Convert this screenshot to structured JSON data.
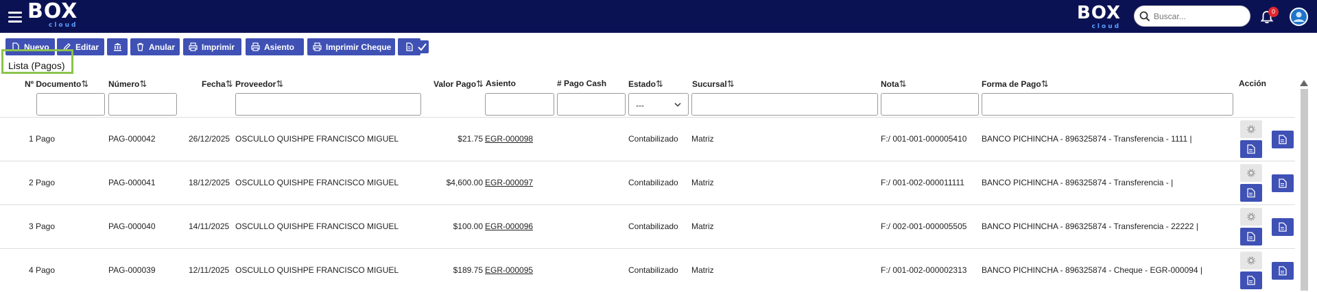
{
  "header": {
    "logo_text": "BOX",
    "logo_sub": "cloud",
    "search_placeholder": "Buscar...",
    "notification_count": "0",
    "brand_color": "#0b1254",
    "accent_color": "#3f51b5"
  },
  "toolbar": {
    "buttons": [
      {
        "label": "Nuevo",
        "icon": "file-icon"
      },
      {
        "label": "Editar",
        "icon": "pencil-icon"
      },
      {
        "label": "",
        "icon": "bank-icon"
      },
      {
        "label": "Anular",
        "icon": "trash-icon"
      },
      {
        "label": "Imprimir",
        "icon": "printer-icon"
      },
      {
        "label": "Asiento",
        "icon": "printer-icon"
      },
      {
        "label": "Imprimir Cheque",
        "icon": "printer-icon"
      },
      {
        "label": "",
        "icon": "pdf-file-icon"
      }
    ],
    "checkbox_checked": true
  },
  "list_title": "Lista (Pagos)",
  "columns": {
    "documento": "Nº Documento",
    "numero": "Número",
    "fecha": "Fecha",
    "proveedor": "Proveedor",
    "valor": "Valor Pago",
    "asiento": "Asiento",
    "pago_cash": "# Pago Cash",
    "estado": "Estado",
    "sucursal": "Sucursal",
    "nota": "Nota",
    "forma_pago": "Forma de Pago",
    "accion": "Acción"
  },
  "sort_indicator": "⇅",
  "estado_filter_value": "---",
  "rows": [
    {
      "doc": "1 Pago",
      "numero": "PAG-000042",
      "fecha": "26/12/2025",
      "proveedor": "OSCULLO QUISHPE FRANCISCO MIGUEL",
      "valor": "$21.75",
      "asiento": "EGR-000098",
      "estado": "Contabilizado",
      "sucursal": "Matriz",
      "nota": "F:/ 001-001-000005410",
      "forma": "BANCO PICHINCHA - 896325874 - Transferencia - 1111 |"
    },
    {
      "doc": "2 Pago",
      "numero": "PAG-000041",
      "fecha": "18/12/2025",
      "proveedor": "OSCULLO QUISHPE FRANCISCO MIGUEL",
      "valor": "$4,600.00",
      "asiento": "EGR-000097",
      "estado": "Contabilizado",
      "sucursal": "Matriz",
      "nota": "F:/ 001-002-000011111",
      "forma": "BANCO PICHINCHA - 896325874 - Transferencia - |"
    },
    {
      "doc": "3 Pago",
      "numero": "PAG-000040",
      "fecha": "14/11/2025",
      "proveedor": "OSCULLO QUISHPE FRANCISCO MIGUEL",
      "valor": "$100.00",
      "asiento": "EGR-000096",
      "estado": "Contabilizado",
      "sucursal": "Matriz",
      "nota": "F:/ 002-001-000005505",
      "forma": "BANCO PICHINCHA - 896325874 - Transferencia - 22222 |"
    },
    {
      "doc": "4 Pago",
      "numero": "PAG-000039",
      "fecha": "12/11/2025",
      "proveedor": "OSCULLO QUISHPE FRANCISCO MIGUEL",
      "valor": "$189.75",
      "asiento": "EGR-000095",
      "estado": "Contabilizado",
      "sucursal": "Matriz",
      "nota": "F:/ 001-002-000002313",
      "forma": "BANCO PICHINCHA - 896325874 - Cheque - EGR-000094 |"
    }
  ]
}
